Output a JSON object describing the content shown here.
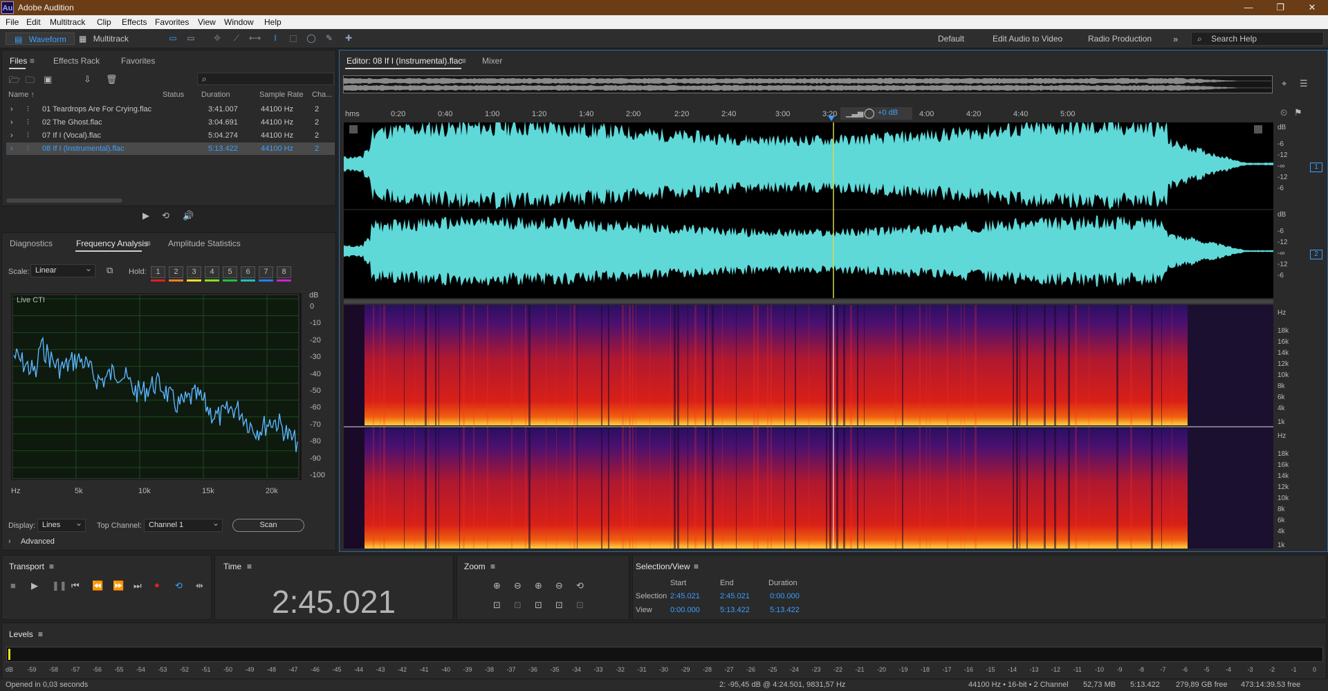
{
  "titlebar": {
    "app_icon": "Au",
    "title": "Adobe Audition"
  },
  "menu": [
    "File",
    "Edit",
    "Multitrack",
    "Clip",
    "Effects",
    "Favorites",
    "View",
    "Window",
    "Help"
  ],
  "toolbar": {
    "waveform": "Waveform",
    "multitrack": "Multitrack",
    "workspaces": [
      "Default",
      "Edit Audio to Video",
      "Radio Production"
    ],
    "search_help": "Search Help"
  },
  "files_panel": {
    "tabs": [
      "Files",
      "Effects Rack",
      "Favorites"
    ],
    "search_placeholder": "",
    "columns": [
      "Name ↑",
      "Status",
      "Duration",
      "Sample Rate",
      "Cha..."
    ],
    "rows": [
      {
        "name": "01 Teardrops Are For Crying.flac",
        "duration": "3:41.007",
        "rate": "44100 Hz",
        "ch": "2"
      },
      {
        "name": "02 The Ghost.flac",
        "duration": "3:04.691",
        "rate": "44100 Hz",
        "ch": "2"
      },
      {
        "name": "07 If I (Vocal).flac",
        "duration": "5:04.274",
        "rate": "44100 Hz",
        "ch": "2"
      },
      {
        "name": "08 If I (Instrumental).flac",
        "duration": "5:13.422",
        "rate": "44100 Hz",
        "ch": "2"
      }
    ]
  },
  "analysis_panel": {
    "tabs": [
      "Diagnostics",
      "Frequency Analysis",
      "Amplitude Statistics"
    ],
    "scale_label": "Scale:",
    "scale_value": "Linear",
    "hold_label": "Hold:",
    "hold": [
      "1",
      "2",
      "3",
      "4",
      "5",
      "6",
      "7",
      "8"
    ],
    "hold_colors": [
      "#e02020",
      "#f08020",
      "#f0e020",
      "#80e020",
      "#20c040",
      "#20c0c0",
      "#2080f0",
      "#d020d0"
    ],
    "live_cti": "Live CTI",
    "db_label": "dB",
    "db_ticks": [
      "0",
      "-10",
      "-20",
      "-30",
      "-40",
      "-50",
      "-60",
      "-70",
      "-80",
      "-90",
      "-100"
    ],
    "hz_ticks": [
      "Hz",
      "5k",
      "10k",
      "15k",
      "20k"
    ],
    "display_label": "Display:",
    "display_value": "Lines",
    "top_channel_label": "Top Channel:",
    "top_channel_value": "Channel 1",
    "scan": "Scan",
    "advanced": "Advanced"
  },
  "editor": {
    "tabs": [
      "Editor: 08 If I (Instrumental).flac",
      "Mixer"
    ],
    "ruler": [
      "hms",
      "0:20",
      "0:40",
      "1:00",
      "1:20",
      "1:40",
      "2:00",
      "2:20",
      "2:40",
      "3:00",
      "3:20",
      "4:00",
      "4:20",
      "4:40",
      "5:00"
    ],
    "gain": "+0 dB",
    "db_scale": [
      "dB",
      "-6",
      "-12",
      "-∞",
      "-12",
      "-6"
    ],
    "channel_badges": [
      "1",
      "2"
    ],
    "hz_scale": [
      "Hz",
      "18k",
      "16k",
      "14k",
      "12k",
      "10k",
      "8k",
      "6k",
      "4k",
      "1k"
    ]
  },
  "transport": {
    "title": "Transport"
  },
  "time": {
    "title": "Time",
    "value": "2:45.021"
  },
  "zoom": {
    "title": "Zoom"
  },
  "selection_view": {
    "title": "Selection/View",
    "cols": [
      "Start",
      "End",
      "Duration"
    ],
    "selection_label": "Selection",
    "view_label": "View",
    "selection": [
      "2:45.021",
      "2:45.021",
      "0:00.000"
    ],
    "view": [
      "0:00.000",
      "5:13.422",
      "5:13.422"
    ]
  },
  "levels": {
    "title": "Levels",
    "ticks": [
      "dB",
      "-59",
      "-58",
      "-57",
      "-56",
      "-55",
      "-54",
      "-53",
      "-52",
      "-51",
      "-50",
      "-49",
      "-48",
      "-47",
      "-46",
      "-45",
      "-44",
      "-43",
      "-42",
      "-41",
      "-40",
      "-39",
      "-38",
      "-37",
      "-36",
      "-35",
      "-34",
      "-33",
      "-32",
      "-31",
      "-30",
      "-29",
      "-28",
      "-27",
      "-26",
      "-25",
      "-24",
      "-23",
      "-22",
      "-21",
      "-20",
      "-19",
      "-18",
      "-17",
      "-16",
      "-15",
      "-14",
      "-13",
      "-12",
      "-11",
      "-10",
      "-9",
      "-8",
      "-7",
      "-6",
      "-5",
      "-4",
      "-3",
      "-2",
      "-1",
      "0"
    ]
  },
  "status": {
    "left": "Opened in 0,03 seconds",
    "cursor": "2: -95,45 dB @ 4:24.501, 9831,57 Hz",
    "format": "44100 Hz • 16-bit • 2 Channel",
    "size": "52,73 MB",
    "duration": "5:13.422",
    "free": "279,89 GB free",
    "free_time": "473:14:39.53 free"
  }
}
